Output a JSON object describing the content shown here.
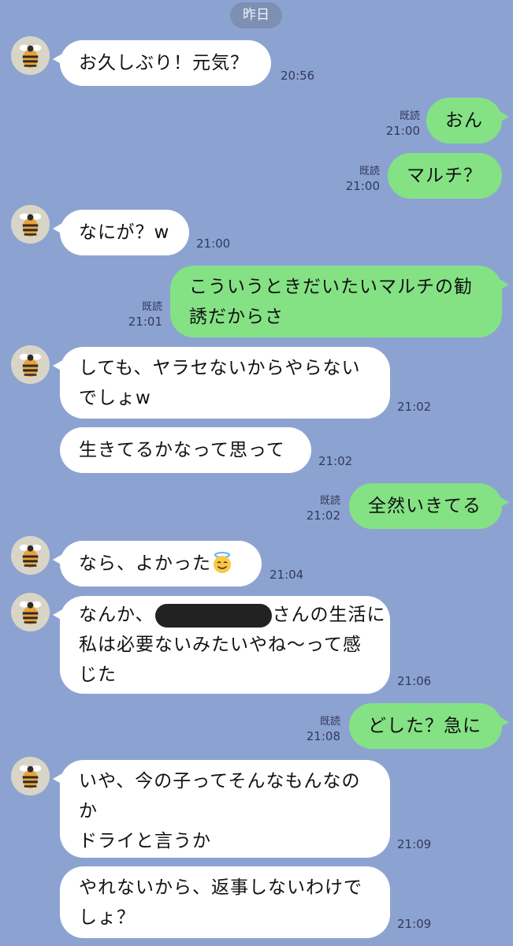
{
  "date_divider": "昨日",
  "read_label": "既読",
  "messages": [
    {
      "lines": [
        "お久しぶり！元気？"
      ],
      "time": "20:56"
    },
    {
      "lines": [
        "おん"
      ],
      "time": "21:00"
    },
    {
      "lines": [
        "マルチ？"
      ],
      "time": "21:00"
    },
    {
      "lines": [
        "なにが？w"
      ],
      "time": "21:00"
    },
    {
      "lines": [
        "こういうときだいたいマルチの勧",
        "誘だからさ"
      ],
      "time": "21:01"
    },
    {
      "lines": [
        "しても、ヤラセないからやらない",
        "でしょw"
      ],
      "time": "21:02"
    },
    {
      "lines": [
        "生きてるかなって思って"
      ],
      "time": "21:02"
    },
    {
      "lines": [
        "全然いきてる"
      ],
      "time": "21:02"
    },
    {
      "lines": [
        "なら、よかった"
      ],
      "time": "21:04"
    },
    {
      "lines": [
        "なんか、",
        "さんの生活に",
        "私は必要ないみたいやね〜って感",
        "じた"
      ],
      "time": "21:06"
    },
    {
      "lines": [
        "どした？急に"
      ],
      "time": "21:08"
    },
    {
      "lines": [
        "いや、今の子ってそんなもんなの",
        "か",
        "ドライと言うか"
      ],
      "time": "21:09"
    },
    {
      "lines": [
        "やれないから、返事しないわけで",
        "しょ？"
      ],
      "time": "21:09"
    }
  ]
}
